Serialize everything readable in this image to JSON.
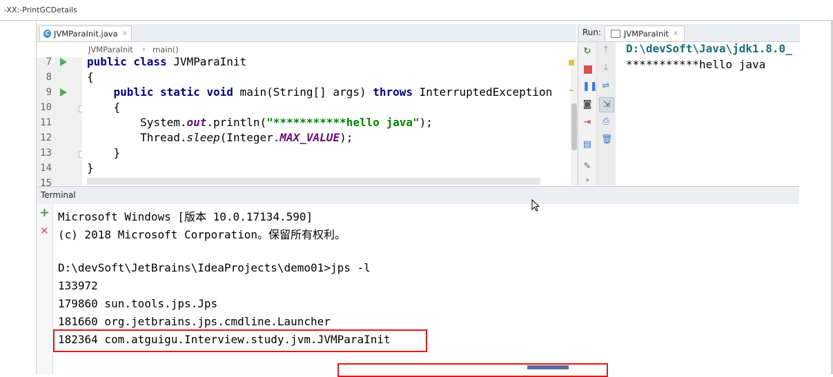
{
  "window": {
    "title": "-XX:-PrintGCDetails"
  },
  "editor": {
    "tab": {
      "label": "JVMParaInit.java",
      "close": "×",
      "icon": "C"
    },
    "breadcrumb": {
      "class": "JVMParaInit",
      "separator": "›",
      "method": "main()"
    },
    "lines": [
      {
        "num": "7",
        "code": "public class JVMParaInit"
      },
      {
        "num": "8",
        "code": "{"
      },
      {
        "num": "9",
        "code": "    public static void main(String[] args) throws InterruptedException"
      },
      {
        "num": "10",
        "code": "    {"
      },
      {
        "num": "11",
        "code": "        System.out.println(\"***********hello java\");"
      },
      {
        "num": "12",
        "code": "        Thread.sleep(Integer.MAX_VALUE);"
      },
      {
        "num": "13",
        "code": "    }"
      },
      {
        "num": "14",
        "code": "}"
      },
      {
        "num": "15",
        "code": ""
      }
    ],
    "code_tokens": {
      "l7_kw": "public class",
      "l7_rest": " JVMParaInit",
      "l9_kw": "public static void",
      "l9_rest": " main(String[] args) ",
      "l9_throws": "throws",
      "l9_exc": " InterruptedException",
      "l11_pre": "System.",
      "l11_out": "out",
      "l11_mid": ".println(",
      "l11_str": "\"***********hello java\"",
      "l11_end": ");",
      "l12_pre": "Thread.",
      "l12_sleep": "sleep",
      "l12_mid": "(Integer.",
      "l12_max": "MAX_VALUE",
      "l12_end": ");"
    }
  },
  "run": {
    "label": "Run:",
    "tab_label": "JVMParaInit",
    "tab_close": "×",
    "output": [
      "D:\\devSoft\\Java\\jdk1.8.0_",
      "***********hello java"
    ],
    "tools_more": "»",
    "colors": {
      "cmd": "#1a6b7a",
      "text": "#000000"
    }
  },
  "terminal": {
    "header": "Terminal",
    "add_icon": "+",
    "close_icon": "✕",
    "lines": [
      "Microsoft Windows [版本 10.0.17134.590]",
      "(c) 2018 Microsoft Corporation。保留所有权利。",
      "",
      "D:\\devSoft\\JetBrains\\IdeaProjects\\demo01>jps -l",
      "133972",
      "179860 sun.tools.jps.Jps",
      "181660 org.jetbrains.jps.cmdline.Launcher",
      "182364 com.atguigu.Interview.study.jvm.JVMParaInit"
    ]
  },
  "colors": {
    "highlight": "#e01818",
    "keyword": "#000080",
    "string": "#008000",
    "field": "#660e7a",
    "runGreen": "#58a85c"
  }
}
